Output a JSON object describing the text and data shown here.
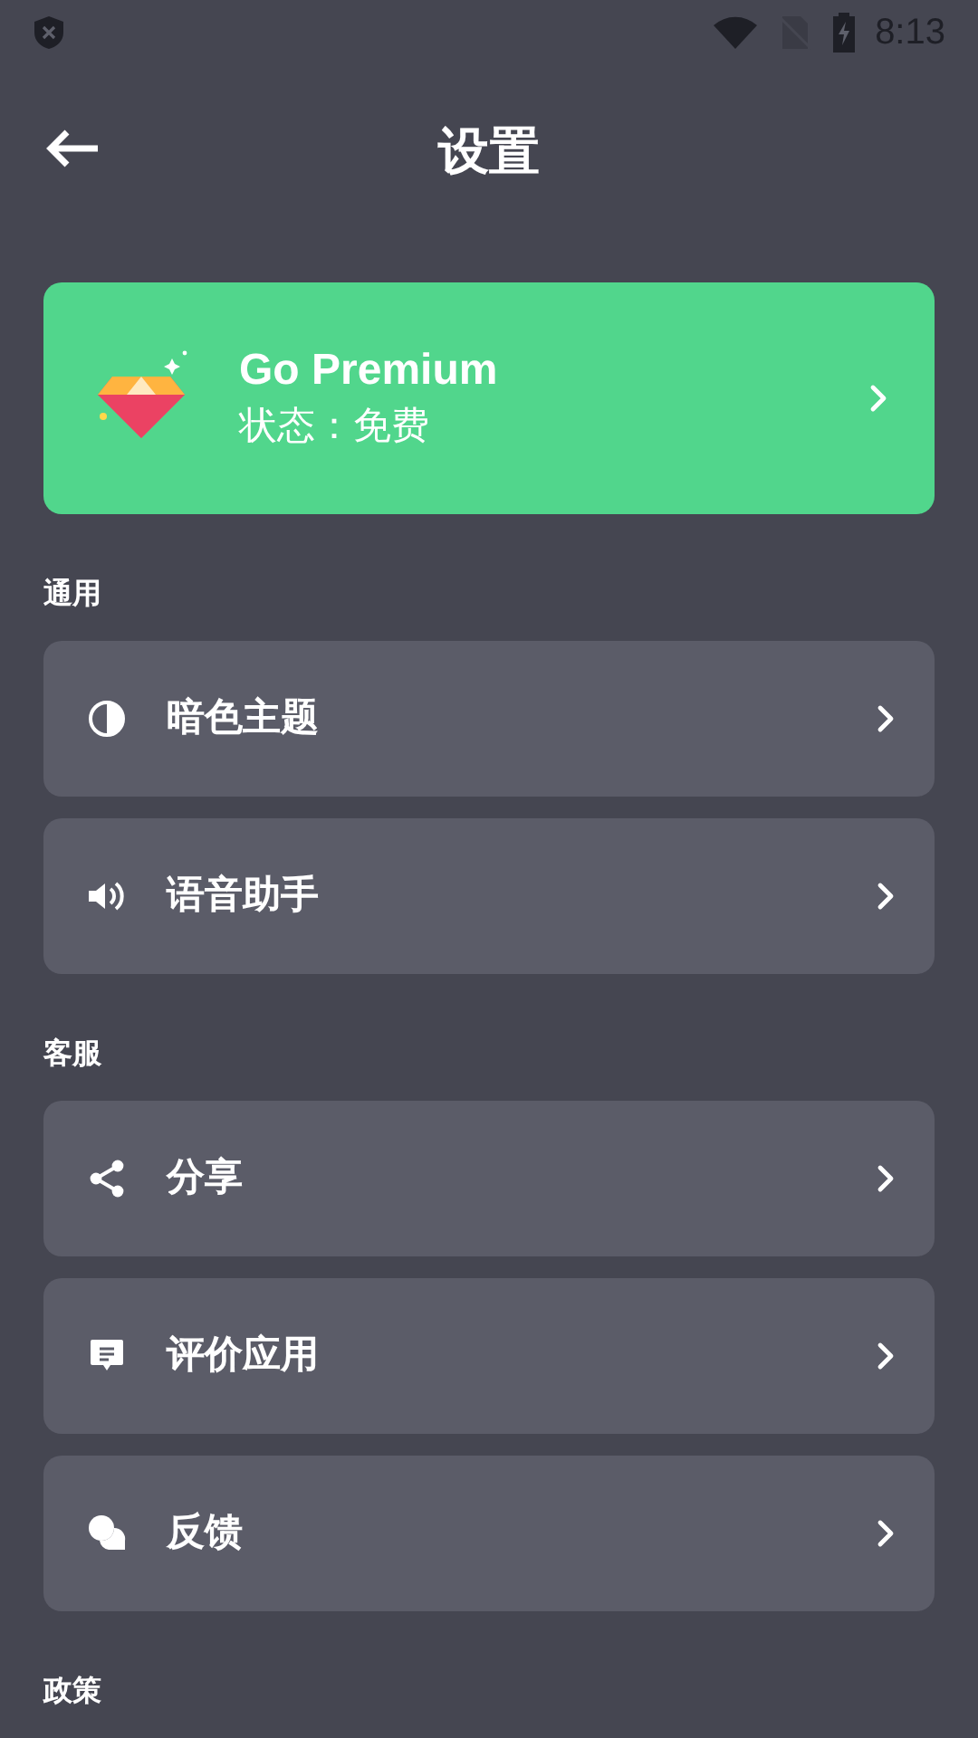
{
  "status_bar": {
    "time": "8:13"
  },
  "header": {
    "title": "设置"
  },
  "premium": {
    "title": "Go Premium",
    "status": "状态：免费"
  },
  "sections": [
    {
      "label": "通用",
      "items": [
        {
          "label": "暗色主题",
          "kind": "contrast"
        },
        {
          "label": "语音助手",
          "kind": "speaker"
        }
      ]
    },
    {
      "label": "客服",
      "items": [
        {
          "label": "分享",
          "kind": "share"
        },
        {
          "label": "评价应用",
          "kind": "review"
        },
        {
          "label": "反馈",
          "kind": "chat"
        }
      ]
    },
    {
      "label": "政策"
    }
  ]
}
